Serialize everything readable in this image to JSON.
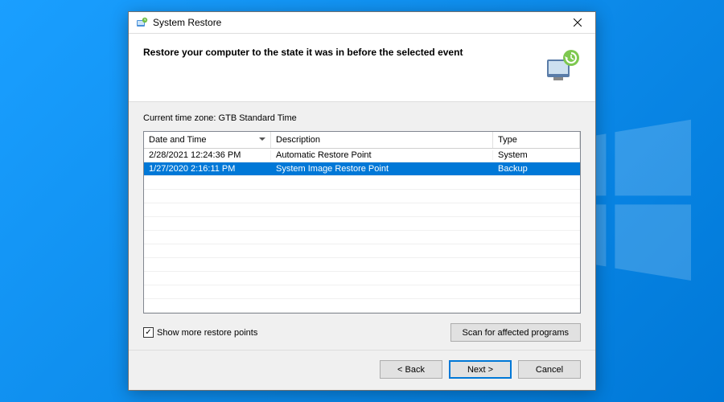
{
  "window": {
    "title": "System Restore",
    "heading": "Restore your computer to the state it was in before the selected event"
  },
  "timezone_label": "Current time zone: GTB Standard Time",
  "grid": {
    "columns": {
      "date": "Date and Time",
      "desc": "Description",
      "type": "Type"
    },
    "rows": [
      {
        "date": "2/28/2021 12:24:36 PM",
        "desc": "Automatic Restore Point",
        "type": "System",
        "selected": false
      },
      {
        "date": "1/27/2020 2:16:11 PM",
        "desc": "System Image Restore Point",
        "type": "Backup",
        "selected": true
      }
    ]
  },
  "checkbox": {
    "label": "Show more restore points",
    "checked": true
  },
  "buttons": {
    "scan": "Scan for affected programs",
    "back": "< Back",
    "next": "Next >",
    "cancel": "Cancel"
  }
}
